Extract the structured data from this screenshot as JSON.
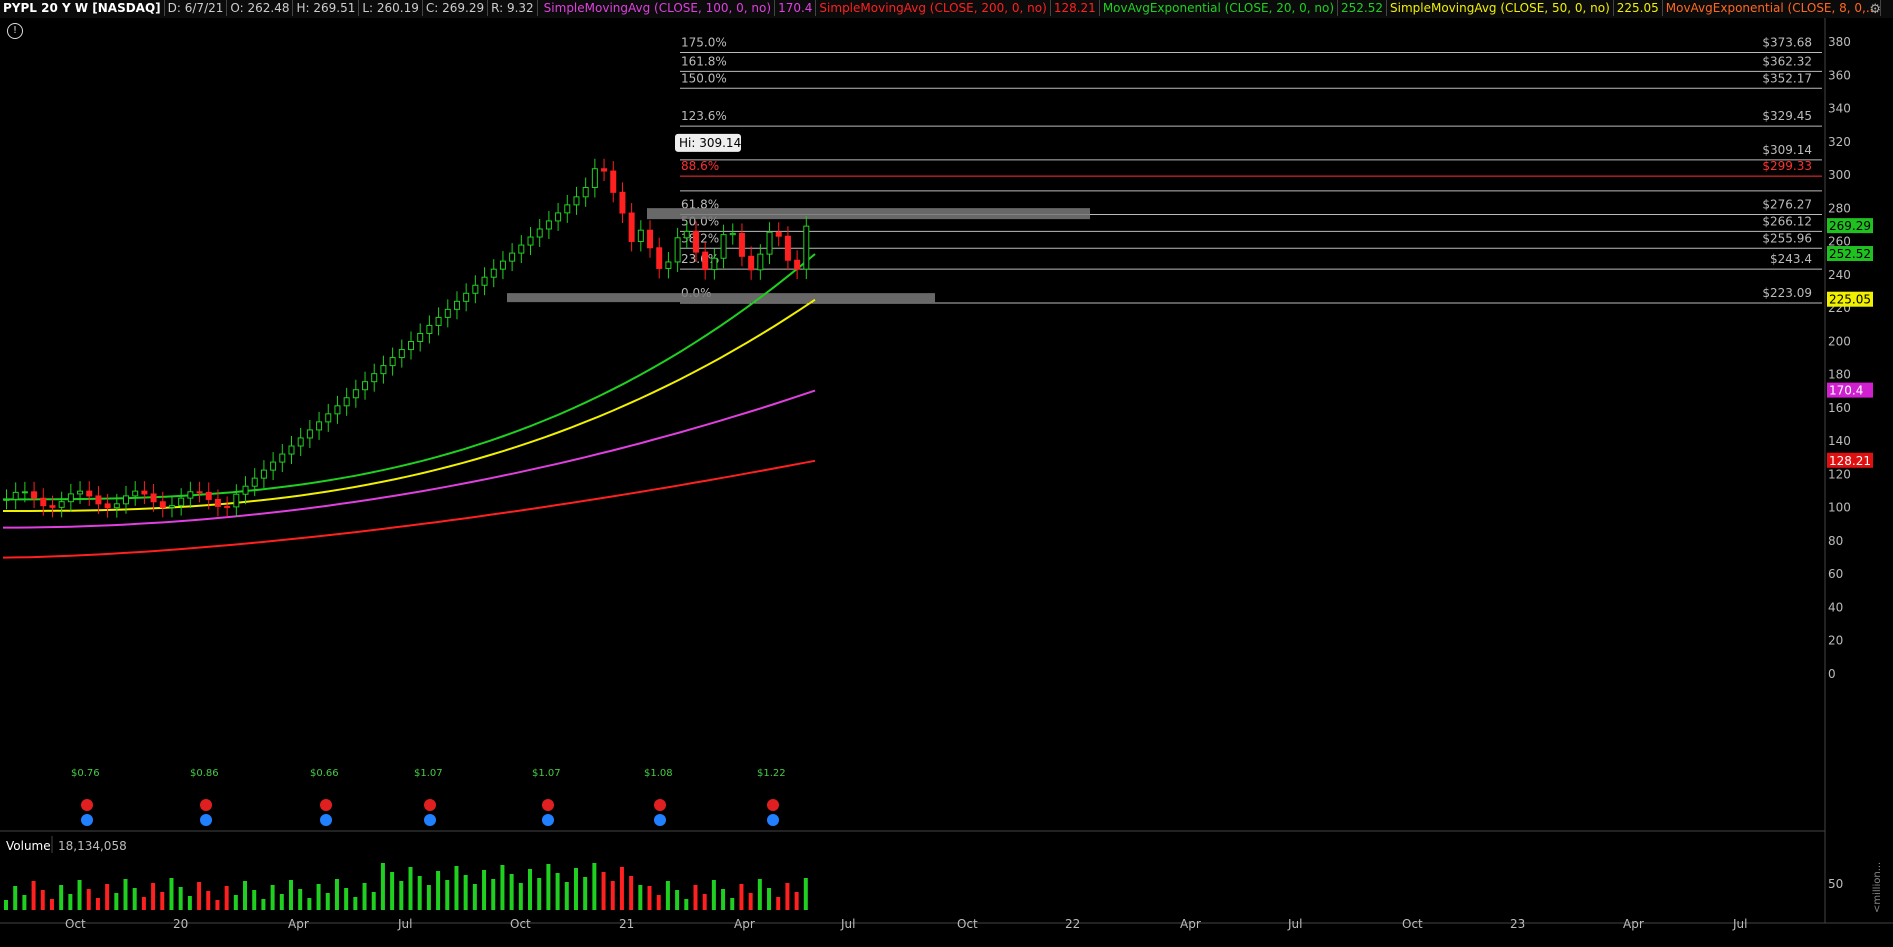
{
  "header": {
    "symbol": "PYPL 20 Y W [NASDAQ]",
    "date": "D: 6/7/21",
    "open": "O: 262.48",
    "high": "H: 269.51",
    "low": "L: 260.19",
    "close": "C: 269.29",
    "range": "R: 9.32",
    "studies": [
      {
        "label": "SimpleMovingAvg (CLOSE, 100, 0, no)",
        "value": "170.4",
        "color": "#e040e0"
      },
      {
        "label": "SimpleMovingAvg (CLOSE, 200, 0, no)",
        "value": "128.21",
        "color": "#ff2020"
      },
      {
        "label": "MovAvgExponential (CLOSE, 20, 0, no)",
        "value": "252.52",
        "color": "#20d020"
      },
      {
        "label": "SimpleMovingAvg (CLOSE, 50, 0, no)",
        "value": "225.05",
        "color": "#f0f000"
      },
      {
        "label": "MovAvgExponential (CLOSE, 8, 0,...",
        "value": "",
        "color": "#ff6820"
      }
    ]
  },
  "volume": {
    "label": "Volume",
    "value": "18,134,058",
    "axis_label": "50",
    "units": "<million..."
  },
  "chart_data": {
    "type": "candlestick",
    "y_axis": {
      "min": 0,
      "max": 380,
      "ticks": [
        0,
        20,
        40,
        60,
        80,
        100,
        120,
        140,
        160,
        180,
        200,
        220,
        240,
        260,
        280,
        300,
        320,
        340,
        360,
        380
      ]
    },
    "x_axis": {
      "labels": [
        "Oct",
        "20",
        "Apr",
        "Jul",
        "Oct",
        "21",
        "Apr",
        "Jul",
        "Oct",
        "22",
        "Apr",
        "Jul",
        "Oct",
        "23",
        "Apr",
        "Jul"
      ]
    },
    "high_label": "Hi: 309.14",
    "fib_levels": [
      {
        "pct": "175.0%",
        "price": "$373.68",
        "value": 373.68,
        "color": "#bbbbbb"
      },
      {
        "pct": "161.8%",
        "price": "$362.32",
        "value": 362.32,
        "color": "#bbbbbb"
      },
      {
        "pct": "150.0%",
        "price": "$352.17",
        "value": 352.17,
        "color": "#bbbbbb"
      },
      {
        "pct": "123.6%",
        "price": "$329.45",
        "value": 329.45,
        "color": "#bbbbbb"
      },
      {
        "pct": "",
        "price": "$309.14",
        "value": 309.14,
        "color": "#bbbbbb"
      },
      {
        "pct": "88.6%",
        "price": "$299.33",
        "value": 299.33,
        "color": "#ff3030"
      },
      {
        "pct": "",
        "price": "",
        "value": 290.5,
        "color": "#bbbbbb"
      },
      {
        "pct": "61.8%",
        "price": "$276.27",
        "value": 276.27,
        "color": "#bbbbbb"
      },
      {
        "pct": "50.0%",
        "price": "$266.12",
        "value": 266.12,
        "color": "#bbbbbb"
      },
      {
        "pct": "38.2%",
        "price": "$255.96",
        "value": 255.96,
        "color": "#bbbbbb"
      },
      {
        "pct": "23.6%",
        "price": "$243.4",
        "value": 243.4,
        "color": "#bbbbbb"
      },
      {
        "pct": "0.0%",
        "price": "$223.09",
        "value": 223.09,
        "color": "#bbbbbb"
      }
    ],
    "price_tags": [
      {
        "value": 269.29,
        "label": "269.29",
        "bg": "#20c020",
        "fg": "#000"
      },
      {
        "value": 252.52,
        "label": "252.52",
        "bg": "#20c020",
        "fg": "#000"
      },
      {
        "value": 225.05,
        "label": "225.05",
        "bg": "#f0f000",
        "fg": "#000"
      },
      {
        "value": 170.4,
        "label": "170.4",
        "bg": "#d020d0",
        "fg": "#fff"
      },
      {
        "value": 128.21,
        "label": "128.21",
        "bg": "#e01010",
        "fg": "#fff"
      }
    ],
    "dividends": [
      "$0.76",
      "$0.86",
      "$0.66",
      "$1.07",
      "$1.07",
      "$1.08",
      "$1.22"
    ],
    "ma_series": [
      {
        "name": "SMA200",
        "color": "#ff2020",
        "start": 70,
        "end": 128.21
      },
      {
        "name": "SMA100",
        "color": "#e040e0",
        "start": 88,
        "end": 170.4
      },
      {
        "name": "SMA50",
        "color": "#f0f000",
        "start": 98,
        "end": 225.05
      },
      {
        "name": "EMA20",
        "color": "#20d020",
        "start": 105,
        "end": 252.52
      }
    ]
  }
}
